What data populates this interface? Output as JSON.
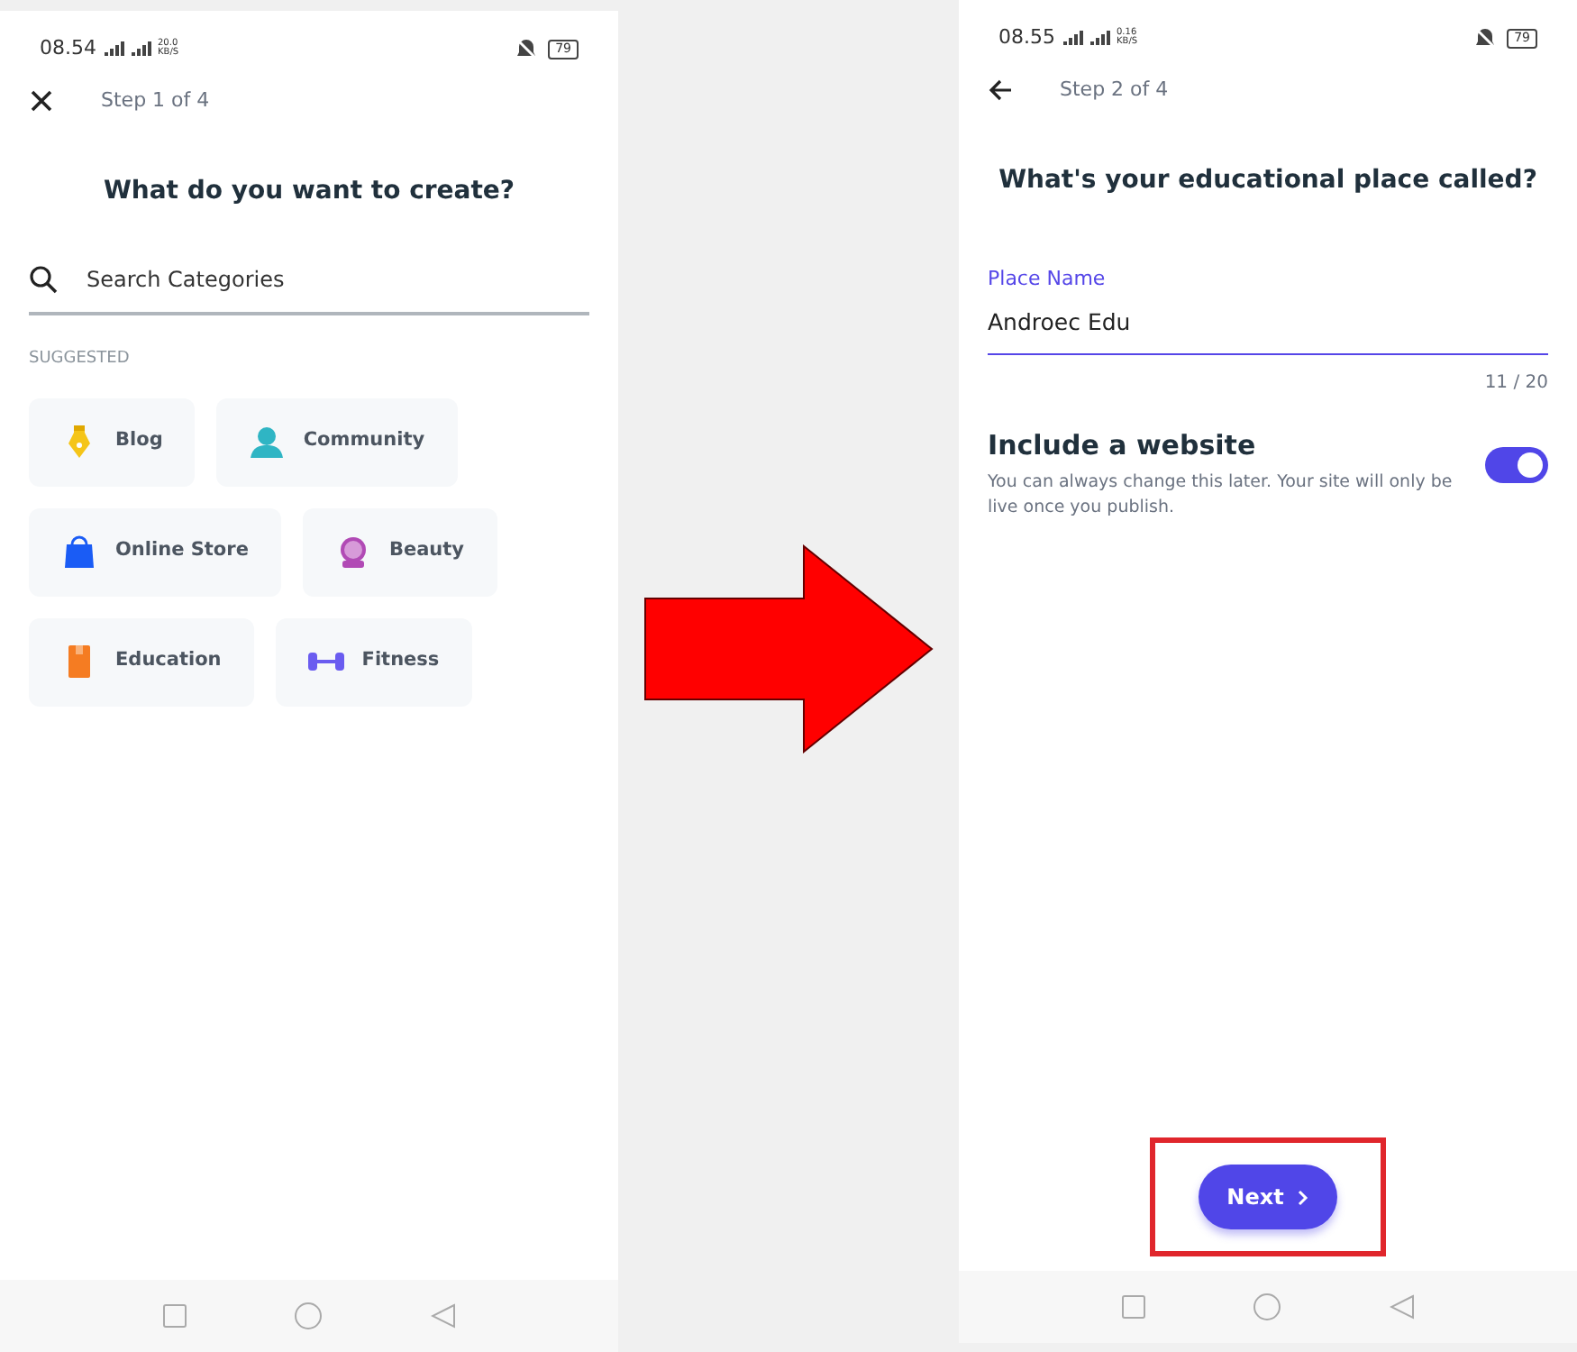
{
  "screens": [
    {
      "kind": "categories",
      "status": {
        "time": "08.54",
        "speed": "20.0 KB/S",
        "battery": "79"
      },
      "header": {
        "step": "Step 1 of 4"
      },
      "title": "What do you want to create?",
      "search": {
        "placeholder": "Search Categories"
      },
      "suggested": {
        "label": "SUGGESTED",
        "rows": [
          [
            {
              "label": "Blog"
            },
            {
              "label": "Community"
            }
          ],
          [
            {
              "label": "Online Store"
            },
            {
              "label": "Beauty"
            }
          ],
          [
            {
              "label": "Education"
            },
            {
              "label": "Fitness"
            }
          ]
        ]
      }
    },
    {
      "kind": "name",
      "status": {
        "time": "08.55",
        "speed": "0.16 KB/S",
        "battery": "79"
      },
      "header": {
        "step": "Step 2 of 4"
      },
      "title": "What's your educational place called?",
      "field": {
        "label": "Place Name",
        "value": "Androec Edu",
        "counter": "11 / 20"
      },
      "website": {
        "title": "Include a website",
        "text": "You can always change this later. Your site will only be live once you publish.",
        "on": true
      },
      "next_button": {
        "label": "Next",
        "highlighted": true
      }
    }
  ]
}
